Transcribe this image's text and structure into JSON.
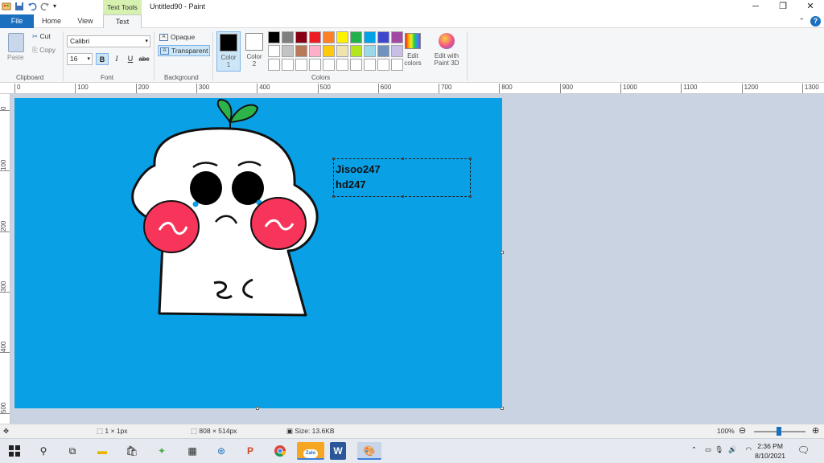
{
  "window": {
    "title": "Untitled90 - Paint",
    "context_tab": "Text Tools",
    "controls": [
      "minimize",
      "restore",
      "close"
    ]
  },
  "tabs": [
    {
      "label": "File"
    },
    {
      "label": "Home"
    },
    {
      "label": "View"
    },
    {
      "label": "Text"
    }
  ],
  "ribbon": {
    "clipboard": {
      "paste": "Paste",
      "cut": "Cut",
      "copy": "Copy",
      "label": "Clipboard"
    },
    "font": {
      "family": "Calibri",
      "size": "16",
      "bold": "B",
      "italic": "I",
      "underline": "U",
      "strikethrough": "abc",
      "label": "Font"
    },
    "background": {
      "opaque": "Opaque",
      "transparent": "Transparent",
      "label": "Background",
      "selected": "Transparent"
    },
    "colors": {
      "color1_label": "Color",
      "color1_num": "1",
      "color2_label": "Color",
      "color2_num": "2",
      "color1": "#000000",
      "color2": "#ffffff",
      "label": "Colors",
      "edit_colors": "Edit colors",
      "edit_with_paint3d": "Edit with Paint 3D",
      "palette": [
        "#000000",
        "#7f7f7f",
        "#880015",
        "#ed1c24",
        "#ff7f27",
        "#fff200",
        "#22b14c",
        "#00a2e8",
        "#3f48cc",
        "#a349a4",
        "#ffffff",
        "#c3c3c3",
        "#b97a57",
        "#ffaec9",
        "#ffc90e",
        "#efe4b0",
        "#b5e61d",
        "#99d9ea",
        "#7092be",
        "#c8bfe7",
        "#ffffff",
        "#ffffff",
        "#ffffff",
        "#ffffff",
        "#ffffff",
        "#ffffff",
        "#ffffff",
        "#ffffff",
        "#ffffff",
        "#ffffff"
      ]
    }
  },
  "ruler": {
    "h_ticks": [
      "0",
      "100",
      "200",
      "300",
      "400",
      "500",
      "600",
      "700",
      "800",
      "900",
      "1000",
      "1100",
      "1200",
      "1300"
    ],
    "v_ticks": [
      "0",
      "100",
      "200",
      "300",
      "400",
      "500"
    ]
  },
  "canvas": {
    "background": "#0aa0e6",
    "text_lines": [
      "Jisoo247",
      "hd247"
    ]
  },
  "statusbar": {
    "selection": "1 × 1px",
    "image_size": "808 × 514px",
    "file_size": "Size: 13.6KB",
    "zoom": "100%"
  },
  "taskbar": {
    "apps": [
      "start",
      "search",
      "task-view",
      "file-explorer",
      "store",
      "clean-master",
      "calculator",
      "teamviewer",
      "powerpoint",
      "chrome",
      "zalo",
      "word",
      "paint"
    ],
    "zalo_label": "Zalo",
    "time": "2:36 PM",
    "date": "8/10/2021"
  }
}
